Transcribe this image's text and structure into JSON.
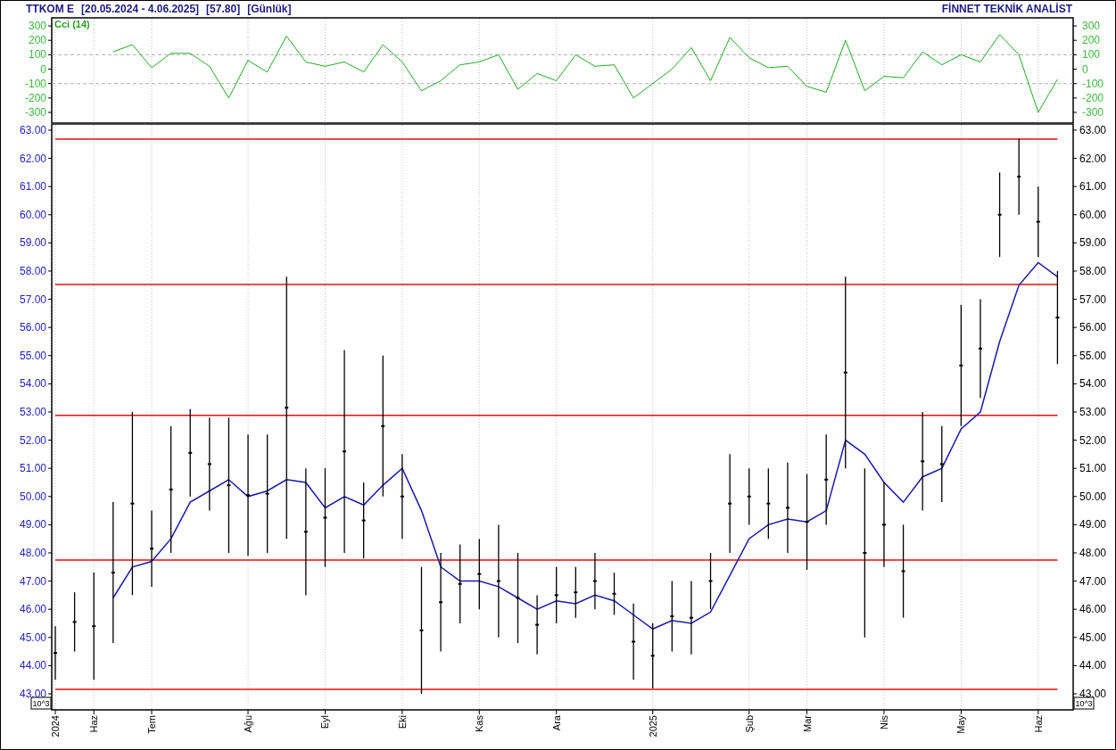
{
  "header": {
    "symbol": "TTKOM E",
    "range": "[20.05.2024 - 4.06.2025]",
    "price": "[57.80]",
    "period": "[Günlük]",
    "brand": "FİNNET TEKNİK ANALİST"
  },
  "cci_panel": {
    "chart_data": {
      "type": "line",
      "title": "Cci (14)",
      "grid": true,
      "ylim": [
        -374,
        356
      ],
      "yticks": [
        {
          "value": 300,
          "label": "300"
        },
        {
          "value": 200,
          "label": "200"
        },
        {
          "value": 100,
          "label": "100"
        },
        {
          "value": 0,
          "label": "0"
        },
        {
          "value": -100,
          "label": "-100"
        },
        {
          "value": -200,
          "label": "-200"
        },
        {
          "value": -300,
          "label": "-300"
        }
      ],
      "series": [
        {
          "color": "#22aa22",
          "values": [
            null,
            null,
            null,
            120,
            170,
            10,
            110,
            110,
            20,
            -200,
            60,
            -20,
            230,
            50,
            20,
            50,
            -20,
            170,
            50,
            -150,
            -80,
            30,
            50,
            100,
            -140,
            -30,
            -80,
            100,
            20,
            30,
            -200,
            -100,
            0,
            150,
            -80,
            220,
            80,
            10,
            20,
            -120,
            -160,
            200,
            -150,
            -50,
            -60,
            120,
            30,
            100,
            50,
            240,
            100,
            -300,
            -70
          ]
        }
      ]
    }
  },
  "price_panel": {
    "unit_labels": [
      "10^3",
      "10^3"
    ],
    "chart_data": {
      "type": "line",
      "grid": true,
      "ylim": [
        42.43,
        63.22
      ],
      "yticks": [
        {
          "value": 63,
          "label": "63.00"
        },
        {
          "value": 62,
          "label": "62.00"
        },
        {
          "value": 61,
          "label": "61.00"
        },
        {
          "value": 60,
          "label": "60.00"
        },
        {
          "value": 59,
          "label": "59.00"
        },
        {
          "value": 58,
          "label": "58.00"
        },
        {
          "value": 57,
          "label": "57.00"
        },
        {
          "value": 56,
          "label": "56.00"
        },
        {
          "value": 55,
          "label": "55.00"
        },
        {
          "value": 54,
          "label": "54.00"
        },
        {
          "value": 53,
          "label": "53.00"
        },
        {
          "value": 52,
          "label": "52.00"
        },
        {
          "value": 51,
          "label": "51.00"
        },
        {
          "value": 50,
          "label": "50.00"
        },
        {
          "value": 49,
          "label": "49.00"
        },
        {
          "value": 48,
          "label": "48.00"
        },
        {
          "value": 47,
          "label": "47.00"
        },
        {
          "value": 46,
          "label": "46.00"
        },
        {
          "value": 45,
          "label": "45.00"
        },
        {
          "value": 44,
          "label": "44.00"
        },
        {
          "value": 43,
          "label": "43.00"
        }
      ],
      "categories": [
        "2024",
        null,
        "Haz",
        null,
        null,
        "Tem",
        null,
        null,
        null,
        null,
        "Ağu",
        null,
        null,
        null,
        "Eyl",
        null,
        null,
        null,
        "Eki",
        null,
        null,
        null,
        "Kas",
        null,
        null,
        null,
        "Ara",
        null,
        null,
        null,
        null,
        "2025",
        null,
        null,
        null,
        null,
        "Şub",
        null,
        null,
        "Mar",
        null,
        null,
        null,
        "Nis",
        null,
        null,
        null,
        "May",
        null,
        null,
        null,
        "Haz",
        null
      ],
      "series": [
        {
          "type": "line",
          "color": "#e01010",
          "values": [
            62.68,
            62.68,
            62.68,
            62.68,
            62.68,
            62.68,
            62.68,
            62.68,
            62.68,
            62.68,
            62.68,
            62.68,
            62.68,
            62.68,
            62.68,
            62.68,
            62.68,
            62.68,
            62.68,
            62.68,
            62.68,
            62.68,
            62.68,
            62.68,
            62.68,
            62.68,
            62.68,
            62.68,
            62.68,
            62.68,
            62.68,
            62.68,
            62.68,
            62.68,
            62.68,
            62.68,
            62.68,
            62.68,
            62.68,
            62.68,
            62.68,
            62.68,
            62.68,
            62.68,
            62.68,
            62.68,
            62.68,
            62.68,
            62.68,
            62.68,
            62.68,
            62.68,
            62.68
          ]
        },
        {
          "type": "line",
          "color": "#e01010",
          "values": [
            57.52,
            57.52,
            57.52,
            57.52,
            57.52,
            57.52,
            57.52,
            57.52,
            57.52,
            57.52,
            57.52,
            57.52,
            57.52,
            57.52,
            57.52,
            57.52,
            57.52,
            57.52,
            57.52,
            57.52,
            57.52,
            57.52,
            57.52,
            57.52,
            57.52,
            57.52,
            57.52,
            57.52,
            57.52,
            57.52,
            57.52,
            57.52,
            57.52,
            57.52,
            57.52,
            57.52,
            57.52,
            57.52,
            57.52,
            57.52,
            57.52,
            57.52,
            57.52,
            57.52,
            57.52,
            57.52,
            57.52,
            57.52,
            57.52,
            57.52,
            57.52,
            57.52,
            57.52
          ]
        },
        {
          "type": "line",
          "color": "#e01010",
          "values": [
            52.88,
            52.88,
            52.88,
            52.88,
            52.88,
            52.88,
            52.88,
            52.88,
            52.88,
            52.88,
            52.88,
            52.88,
            52.88,
            52.88,
            52.88,
            52.88,
            52.88,
            52.88,
            52.88,
            52.88,
            52.88,
            52.88,
            52.88,
            52.88,
            52.88,
            52.88,
            52.88,
            52.88,
            52.88,
            52.88,
            52.88,
            52.88,
            52.88,
            52.88,
            52.88,
            52.88,
            52.88,
            52.88,
            52.88,
            52.88,
            52.88,
            52.88,
            52.88,
            52.88,
            52.88,
            52.88,
            52.88,
            52.88,
            52.88,
            52.88,
            52.88,
            52.88,
            52.88
          ]
        },
        {
          "type": "line",
          "color": "#e01010",
          "values": [
            47.75,
            47.75,
            47.75,
            47.75,
            47.75,
            47.75,
            47.75,
            47.75,
            47.75,
            47.75,
            47.75,
            47.75,
            47.75,
            47.75,
            47.75,
            47.75,
            47.75,
            47.75,
            47.75,
            47.75,
            47.75,
            47.75,
            47.75,
            47.75,
            47.75,
            47.75,
            47.75,
            47.75,
            47.75,
            47.75,
            47.75,
            47.75,
            47.75,
            47.75,
            47.75,
            47.75,
            47.75,
            47.75,
            47.75,
            47.75,
            47.75,
            47.75,
            47.75,
            47.75,
            47.75,
            47.75,
            47.75,
            47.75,
            47.75,
            47.75,
            47.75,
            47.75,
            47.75
          ]
        },
        {
          "type": "line",
          "color": "#e01010",
          "values": [
            43.16,
            43.16,
            43.16,
            43.16,
            43.16,
            43.16,
            43.16,
            43.16,
            43.16,
            43.16,
            43.16,
            43.16,
            43.16,
            43.16,
            43.16,
            43.16,
            43.16,
            43.16,
            43.16,
            43.16,
            43.16,
            43.16,
            43.16,
            43.16,
            43.16,
            43.16,
            43.16,
            43.16,
            43.16,
            43.16,
            43.16,
            43.16,
            43.16,
            43.16,
            43.16,
            43.16,
            43.16,
            43.16,
            43.16,
            43.16,
            43.16,
            43.16,
            43.16,
            43.16,
            43.16,
            43.16,
            43.16,
            43.16,
            43.16,
            43.16,
            43.16,
            43.16,
            43.16
          ]
        },
        {
          "type": "scatter",
          "color": "#000000",
          "values": [
            44.45,
            45.55,
            45.4,
            47.3,
            49.75,
            48.15,
            50.25,
            51.55,
            51.15,
            50.4,
            50.05,
            50.1,
            53.15,
            48.75,
            49.25,
            51.6,
            49.15,
            52.5,
            50.0,
            45.25,
            46.25,
            46.9,
            47.25,
            47.0,
            46.4,
            45.45,
            46.5,
            46.6,
            47.0,
            46.55,
            44.85,
            44.35,
            45.75,
            45.7,
            47.0,
            49.75,
            50.0,
            49.75,
            49.6,
            49.1,
            50.6,
            54.4,
            48.0,
            49.0,
            47.35,
            51.25,
            51.15,
            54.65,
            55.25,
            60.0,
            61.35,
            59.75,
            56.35
          ],
          "errors": [
            0.95,
            1.05,
            1.9,
            2.5,
            3.25,
            1.35,
            2.25,
            1.55,
            1.65,
            2.4,
            2.15,
            2.1,
            4.65,
            2.25,
            1.75,
            3.6,
            1.35,
            2.5,
            1.5,
            2.25,
            1.75,
            1.4,
            1.25,
            2.0,
            1.6,
            1.05,
            1.0,
            0.9,
            1.0,
            0.75,
            1.35,
            1.15,
            1.25,
            1.3,
            1.0,
            1.75,
            1.0,
            1.25,
            1.6,
            1.7,
            1.6,
            3.4,
            3.0,
            1.5,
            1.65,
            1.75,
            1.35,
            2.15,
            1.75,
            1.5,
            1.35,
            1.25,
            1.65
          ]
        },
        {
          "type": "line",
          "color": "#1a1aa8",
          "values": [
            null,
            null,
            null,
            46.4,
            47.5,
            47.7,
            48.5,
            49.8,
            50.2,
            50.6,
            50.0,
            50.2,
            50.6,
            50.5,
            49.6,
            50.0,
            49.7,
            50.4,
            51.0,
            49.5,
            47.5,
            47.0,
            47.0,
            46.8,
            46.4,
            46.0,
            46.3,
            46.2,
            46.5,
            46.3,
            45.8,
            45.3,
            45.6,
            45.5,
            45.9,
            47.2,
            48.5,
            49.0,
            49.2,
            49.1,
            49.5,
            52.0,
            51.5,
            50.5,
            49.8,
            50.7,
            51.0,
            52.4,
            53.0,
            55.5,
            57.5,
            58.3,
            57.8
          ]
        }
      ]
    }
  }
}
